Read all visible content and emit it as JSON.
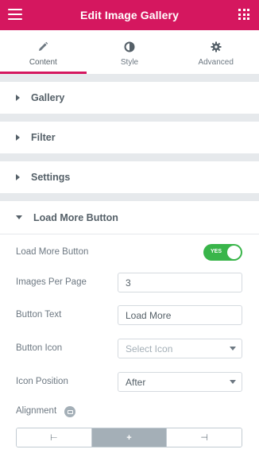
{
  "header": {
    "title": "Edit Image Gallery",
    "menu_icon": "hamburger-icon",
    "apps_icon": "grid-icon",
    "accent_color": "#d5175f"
  },
  "tabs": [
    {
      "label": "Content",
      "icon": "pencil-icon",
      "active": true
    },
    {
      "label": "Style",
      "icon": "half-circle-icon",
      "active": false
    },
    {
      "label": "Advanced",
      "icon": "gear-icon",
      "active": false
    }
  ],
  "sections": [
    {
      "title": "Gallery",
      "expanded": false
    },
    {
      "title": "Filter",
      "expanded": false
    },
    {
      "title": "Settings",
      "expanded": false
    },
    {
      "title": "Load More Button",
      "expanded": true
    }
  ],
  "load_more": {
    "toggle_label": "Load More Button",
    "toggle_state": "YES",
    "toggle_color": "#39b54a",
    "per_page_label": "Images Per Page",
    "per_page_value": "3",
    "button_text_label": "Button Text",
    "button_text_value": "Load More",
    "button_icon_label": "Button Icon",
    "button_icon_placeholder": "Select Icon",
    "icon_position_label": "Icon Position",
    "icon_position_value": "After",
    "alignment_label": "Alignment",
    "alignment_options": [
      {
        "icon": "align-left-icon",
        "glyph": "⊢"
      },
      {
        "icon": "align-center-icon",
        "glyph": "+"
      },
      {
        "icon": "align-right-icon",
        "glyph": "⊣"
      }
    ],
    "alignment_selected": "center"
  }
}
